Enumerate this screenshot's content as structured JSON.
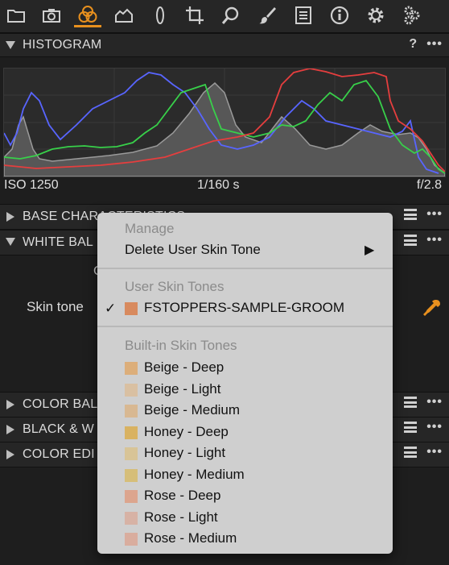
{
  "toolbar": {
    "icons": [
      "folder-icon",
      "camera-icon",
      "color-icon",
      "exposure-icon",
      "lens-icon",
      "crop-icon",
      "search-icon",
      "brush-icon",
      "metadata-icon",
      "info-icon",
      "gear-icon",
      "gears-icon"
    ],
    "active": "color-icon",
    "accent": "#e8901e"
  },
  "histogram": {
    "title": "HISTOGRAM",
    "help": "?",
    "iso": "ISO 1250",
    "shutter": "1/160 s",
    "aperture": "f/2.8"
  },
  "panels": {
    "base_characteristics": "BASE CHARACTERISTICS",
    "white_balance": "WHITE BAL",
    "white_balance_partial_row": "C",
    "skin_tone_label": "Skin tone",
    "color_balance": "COLOR BAL",
    "black_white": "BLACK & W",
    "color_editor": "COLOR EDI"
  },
  "menu": {
    "manage_header": "Manage",
    "delete_item": "Delete User Skin Tone",
    "submenu_arrow": "▶",
    "user_header": "User Skin Tones",
    "user_tone": {
      "label": "FSTOPPERS-SAMPLE-GROOM",
      "color": "#d88a5e",
      "checked": "✓"
    },
    "builtin_header": "Built-in Skin Tones",
    "builtin": [
      {
        "label": "Beige - Deep",
        "color": "#dcae7a"
      },
      {
        "label": "Beige - Light",
        "color": "#d9c0a2"
      },
      {
        "label": "Beige - Medium",
        "color": "#d8b892"
      },
      {
        "label": "Honey - Deep",
        "color": "#d9b261"
      },
      {
        "label": "Honey - Light",
        "color": "#d8c497"
      },
      {
        "label": "Honey - Medium",
        "color": "#d6be79"
      },
      {
        "label": "Rose - Deep",
        "color": "#dca58e"
      },
      {
        "label": "Rose - Light",
        "color": "#d7b2a5"
      },
      {
        "label": "Rose - Medium",
        "color": "#d9ad9e"
      }
    ]
  }
}
